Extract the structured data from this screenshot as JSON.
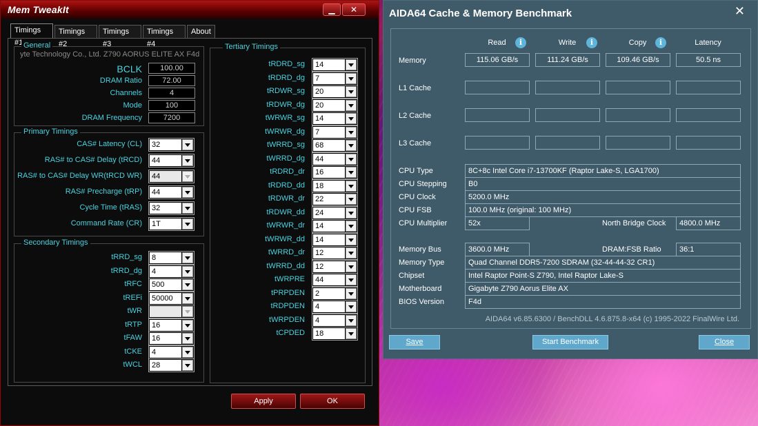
{
  "memtweakit": {
    "title": "Mem TweakIt",
    "min_symbol": "▁",
    "close_symbol": "✕",
    "tabs": [
      "Timings #1",
      "Timings #2",
      "Timings #3",
      "Timings #4",
      "About"
    ],
    "active_tab": "Timings #1",
    "general": {
      "caption": "General",
      "board": "yte Technology Co., Ltd. Z790 AORUS ELITE AX F4d",
      "fields": [
        {
          "label": "BCLK",
          "value": "100.00"
        },
        {
          "label": "DRAM Ratio",
          "value": "72.00"
        },
        {
          "label": "Channels",
          "value": "4"
        },
        {
          "label": "Mode",
          "value": "100"
        },
        {
          "label": "DRAM Frequency",
          "value": "7200"
        }
      ]
    },
    "primary": {
      "caption": "Primary Timings",
      "fields": [
        {
          "label": "CAS# Latency (CL)",
          "value": "32"
        },
        {
          "label": "RAS# to CAS# Delay (tRCD)",
          "value": "44"
        },
        {
          "label": "RAS# to CAS# Delay WR(tRCD WR)",
          "value": "44"
        },
        {
          "label": "RAS# Precharge (tRP)",
          "value": "44"
        },
        {
          "label": "Cycle Time (tRAS)",
          "value": "32"
        },
        {
          "label": "Command Rate (CR)",
          "value": "1T"
        }
      ]
    },
    "secondary": {
      "caption": "Secondary Timings",
      "fields": [
        {
          "label": "tRRD_sg",
          "value": "8"
        },
        {
          "label": "tRRD_dg",
          "value": "4"
        },
        {
          "label": "tRFC",
          "value": "500"
        },
        {
          "label": "tREFi",
          "value": "50000"
        },
        {
          "label": "tWR",
          "value": ""
        },
        {
          "label": "tRTP",
          "value": "16"
        },
        {
          "label": "tFAW",
          "value": "16"
        },
        {
          "label": "tCKE",
          "value": "4"
        },
        {
          "label": "tWCL",
          "value": "28"
        }
      ]
    },
    "tertiary": {
      "caption": "Tertiary Timings",
      "fields": [
        {
          "label": "tRDRD_sg",
          "value": "14"
        },
        {
          "label": "tRDRD_dg",
          "value": "7"
        },
        {
          "label": "tRDWR_sg",
          "value": "20"
        },
        {
          "label": "tRDWR_dg",
          "value": "20"
        },
        {
          "label": "tWRWR_sg",
          "value": "14"
        },
        {
          "label": "tWRWR_dg",
          "value": "7"
        },
        {
          "label": "tWRRD_sg",
          "value": "68"
        },
        {
          "label": "tWRRD_dg",
          "value": "44"
        },
        {
          "label": "tRDRD_dr",
          "value": "16"
        },
        {
          "label": "tRDRD_dd",
          "value": "18"
        },
        {
          "label": "tRDWR_dr",
          "value": "22"
        },
        {
          "label": "tRDWR_dd",
          "value": "24"
        },
        {
          "label": "tWRWR_dr",
          "value": "14"
        },
        {
          "label": "tWRWR_dd",
          "value": "14"
        },
        {
          "label": "tWRRD_dr",
          "value": "12"
        },
        {
          "label": "tWRRD_dd",
          "value": "12"
        },
        {
          "label": "tWRPRE",
          "value": "44"
        },
        {
          "label": "tPRPDEN",
          "value": "2"
        },
        {
          "label": "tRDPDEN",
          "value": "4"
        },
        {
          "label": "tWRPDEN",
          "value": "4"
        },
        {
          "label": "tCPDED",
          "value": "18"
        }
      ]
    },
    "apply_label": "Apply",
    "ok_label": "OK"
  },
  "aida": {
    "title": "AIDA64 Cache & Memory Benchmark",
    "close_symbol": "✕",
    "info_symbol": "i",
    "headers": [
      "Read",
      "Write",
      "Copy",
      "Latency"
    ],
    "rows": [
      {
        "label": "Memory",
        "values": [
          "115.06 GB/s",
          "111.24 GB/s",
          "109.46 GB/s",
          "50.5 ns"
        ]
      },
      {
        "label": "L1 Cache",
        "values": [
          "",
          "",
          "",
          ""
        ]
      },
      {
        "label": "L2 Cache",
        "values": [
          "",
          "",
          "",
          ""
        ]
      },
      {
        "label": "L3 Cache",
        "values": [
          "",
          "",
          "",
          ""
        ]
      }
    ],
    "cpu_type_label": "CPU Type",
    "cpu_type": "8C+8c Intel Core i7-13700KF  (Raptor Lake-S, LGA1700)",
    "cpu_stepping_label": "CPU Stepping",
    "cpu_stepping": "B0",
    "cpu_clock_label": "CPU Clock",
    "cpu_clock": "5200.0 MHz",
    "cpu_fsb_label": "CPU FSB",
    "cpu_fsb": "100.0 MHz  (original: 100 MHz)",
    "cpu_mult_label": "CPU Multiplier",
    "cpu_mult": "52x",
    "nb_clock_label": "North Bridge Clock",
    "nb_clock": "4800.0 MHz",
    "mem_bus_label": "Memory Bus",
    "mem_bus": "3600.0 MHz",
    "dram_fsb_label": "DRAM:FSB Ratio",
    "dram_fsb": "36:1",
    "mem_type_label": "Memory Type",
    "mem_type": "Quad Channel DDR5-7200 SDRAM  (32-44-44-32 CR1)",
    "chipset_label": "Chipset",
    "chipset": "Intel Raptor Point-S Z790, Intel Raptor Lake-S",
    "mobo_label": "Motherboard",
    "mobo": "Gigabyte Z790 Aorus Elite AX",
    "bios_label": "BIOS Version",
    "bios": "F4d",
    "footer": "AIDA64 v6.85.6300 / BenchDLL 4.6.875.8-x64  (c) 1995-2022 FinalWire Ltd.",
    "save_label": "Save",
    "start_label": "Start Benchmark",
    "close_label": "Close"
  }
}
